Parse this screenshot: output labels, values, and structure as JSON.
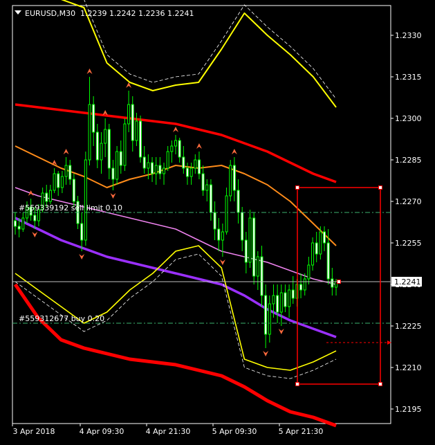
{
  "header": {
    "symbol": "EURUSD,M30",
    "ohlc": "1.2239 1.2242 1.2236 1.2241"
  },
  "chart_data": {
    "type": "line",
    "title": "EURUSD,M30  1.2239 1.2242 1.2236 1.2241",
    "xlabel": "",
    "ylabel": "",
    "ylim": [
      1.219,
      1.234
    ],
    "y_ticks": [
      1.233,
      1.2315,
      1.23,
      1.2285,
      1.227,
      1.2255,
      1.224,
      1.2225,
      1.221,
      1.2195
    ],
    "y_tick_labels": [
      "1.2330",
      "1.2315",
      "1.2300",
      "1.2285",
      "1.2270",
      "1.2255",
      "1.2240",
      "1.2225",
      "1.2210",
      "1.2195"
    ],
    "x_tick_labels": [
      "3 Apr 2018",
      "4 Apr 09:30",
      "4 Apr 21:30",
      "5 Apr 09:30",
      "5 Apr 21:30"
    ],
    "current_price": 1.2241,
    "current_price_label": "1.2241",
    "orders": [
      {
        "label": "#559339192 sell limit 0.10",
        "price": 1.2266
      },
      {
        "label": "#559312677 buy 0.20",
        "price": 1.2226
      }
    ],
    "candles": [
      [
        1.2263,
        1.2266,
        1.2258,
        1.2261
      ],
      [
        1.2261,
        1.2264,
        1.2257,
        1.226
      ],
      [
        1.226,
        1.2266,
        1.2259,
        1.2264
      ],
      [
        1.2264,
        1.227,
        1.2262,
        1.2268
      ],
      [
        1.2268,
        1.2271,
        1.2263,
        1.2265
      ],
      [
        1.2265,
        1.2268,
        1.226,
        1.2263
      ],
      [
        1.2263,
        1.2269,
        1.2261,
        1.2267
      ],
      [
        1.2267,
        1.2275,
        1.2266,
        1.2273
      ],
      [
        1.2273,
        1.2276,
        1.2268,
        1.227
      ],
      [
        1.227,
        1.2276,
        1.2269,
        1.2274
      ],
      [
        1.2274,
        1.2282,
        1.2273,
        1.228
      ],
      [
        1.228,
        1.2281,
        1.2272,
        1.2275
      ],
      [
        1.2275,
        1.2281,
        1.2273,
        1.2279
      ],
      [
        1.2279,
        1.2286,
        1.2276,
        1.2283
      ],
      [
        1.2283,
        1.2285,
        1.2276,
        1.2278
      ],
      [
        1.2278,
        1.228,
        1.2268,
        1.227
      ],
      [
        1.227,
        1.2272,
        1.226,
        1.2262
      ],
      [
        1.2262,
        1.2266,
        1.2252,
        1.2256
      ],
      [
        1.2256,
        1.2288,
        1.2254,
        1.2285
      ],
      [
        1.2285,
        1.2315,
        1.2283,
        1.2305
      ],
      [
        1.2305,
        1.2308,
        1.229,
        1.2295
      ],
      [
        1.2295,
        1.2298,
        1.2282,
        1.2285
      ],
      [
        1.2285,
        1.2295,
        1.228,
        1.2291
      ],
      [
        1.2291,
        1.23,
        1.2286,
        1.2296
      ],
      [
        1.2296,
        1.2298,
        1.2278,
        1.2282
      ],
      [
        1.2282,
        1.2285,
        1.2274,
        1.2278
      ],
      [
        1.2278,
        1.229,
        1.2276,
        1.2288
      ],
      [
        1.2288,
        1.2292,
        1.228,
        1.2283
      ],
      [
        1.2283,
        1.23,
        1.2281,
        1.2298
      ],
      [
        1.2298,
        1.231,
        1.2295,
        1.2305
      ],
      [
        1.2305,
        1.2308,
        1.2288,
        1.2292
      ],
      [
        1.2292,
        1.2302,
        1.229,
        1.2299
      ],
      [
        1.2299,
        1.2301,
        1.2284,
        1.2286
      ],
      [
        1.2286,
        1.229,
        1.228,
        1.2282
      ],
      [
        1.2282,
        1.2287,
        1.2278,
        1.2284
      ],
      [
        1.2284,
        1.2286,
        1.2277,
        1.228
      ],
      [
        1.228,
        1.2286,
        1.2276,
        1.2283
      ],
      [
        1.2283,
        1.2286,
        1.2278,
        1.228
      ],
      [
        1.228,
        1.2284,
        1.2276,
        1.2282
      ],
      [
        1.2282,
        1.229,
        1.2281,
        1.2288
      ],
      [
        1.2288,
        1.2292,
        1.2284,
        1.229
      ],
      [
        1.229,
        1.2294,
        1.2287,
        1.2292
      ],
      [
        1.2292,
        1.2293,
        1.2284,
        1.2286
      ],
      [
        1.2286,
        1.229,
        1.228,
        1.2282
      ],
      [
        1.2282,
        1.2284,
        1.2276,
        1.2279
      ],
      [
        1.2279,
        1.2284,
        1.2276,
        1.2282
      ],
      [
        1.2282,
        1.2287,
        1.228,
        1.2285
      ],
      [
        1.2285,
        1.2288,
        1.2278,
        1.228
      ],
      [
        1.228,
        1.2283,
        1.2272,
        1.2274
      ],
      [
        1.2274,
        1.2278,
        1.227,
        1.2276
      ],
      [
        1.2276,
        1.2278,
        1.2263,
        1.2266
      ],
      [
        1.2266,
        1.227,
        1.2256,
        1.226
      ],
      [
        1.226,
        1.2264,
        1.2252,
        1.2256
      ],
      [
        1.2256,
        1.2262,
        1.225,
        1.2259
      ],
      [
        1.2259,
        1.2275,
        1.2258,
        1.2272
      ],
      [
        1.2272,
        1.2285,
        1.227,
        1.2283
      ],
      [
        1.2283,
        1.2286,
        1.227,
        1.2274
      ],
      [
        1.2274,
        1.2278,
        1.2262,
        1.2266
      ],
      [
        1.2266,
        1.2268,
        1.2252,
        1.2256
      ],
      [
        1.2256,
        1.2259,
        1.2244,
        1.2248
      ],
      [
        1.2248,
        1.2267,
        1.2246,
        1.2264
      ],
      [
        1.2264,
        1.2266,
        1.224,
        1.2243
      ],
      [
        1.2243,
        1.2252,
        1.2238,
        1.225
      ],
      [
        1.225,
        1.2254,
        1.2232,
        1.2236
      ],
      [
        1.2236,
        1.224,
        1.2217,
        1.2222
      ],
      [
        1.2222,
        1.2236,
        1.2219,
        1.2233
      ],
      [
        1.2233,
        1.224,
        1.2228,
        1.2236
      ],
      [
        1.2236,
        1.224,
        1.2226,
        1.223
      ],
      [
        1.223,
        1.224,
        1.2225,
        1.2237
      ],
      [
        1.2237,
        1.224,
        1.223,
        1.2232
      ],
      [
        1.2232,
        1.224,
        1.2228,
        1.2238
      ],
      [
        1.2238,
        1.2243,
        1.2233,
        1.2235
      ],
      [
        1.2235,
        1.2242,
        1.2232,
        1.224
      ],
      [
        1.224,
        1.2244,
        1.2235,
        1.2238
      ],
      [
        1.2238,
        1.2244,
        1.2236,
        1.2242
      ],
      [
        1.2242,
        1.225,
        1.224,
        1.2247
      ],
      [
        1.2247,
        1.2257,
        1.2245,
        1.2255
      ],
      [
        1.2255,
        1.2259,
        1.2248,
        1.2251
      ],
      [
        1.2251,
        1.2261,
        1.2249,
        1.2259
      ],
      [
        1.2259,
        1.2261,
        1.2252,
        1.2255
      ],
      [
        1.2255,
        1.226,
        1.224,
        1.2242
      ],
      [
        1.2242,
        1.2246,
        1.2236,
        1.2239
      ],
      [
        1.2239,
        1.2242,
        1.2236,
        1.2241
      ]
    ],
    "series": [
      {
        "color": "#ff0000",
        "values": [
          1.2305,
          1.2304,
          1.2303,
          1.2302,
          1.2301,
          1.23,
          1.2299,
          1.2298,
          1.2296,
          1.2294,
          1.2291,
          1.2288,
          1.2284,
          1.228,
          1.2277
        ]
      },
      {
        "color": "#ff8c1a",
        "values": [
          1.229,
          1.2286,
          1.2282,
          1.2279,
          1.2275,
          1.2278,
          1.228,
          1.2283,
          1.2282,
          1.2283,
          1.228,
          1.2276,
          1.227,
          1.2262,
          1.2254
        ]
      },
      {
        "color": "#ee82ee",
        "values": [
          1.2275,
          1.2272,
          1.227,
          1.2268,
          1.2266,
          1.2264,
          1.2262,
          1.226,
          1.2256,
          1.2252,
          1.225,
          1.2248,
          1.2245,
          1.2242,
          1.224
        ]
      },
      {
        "color": "#9b30ff",
        "values": [
          1.2264,
          1.226,
          1.2256,
          1.2253,
          1.225,
          1.2248,
          1.2246,
          1.2244,
          1.2242,
          1.224,
          1.2236,
          1.2231,
          1.2227,
          1.2224,
          1.2221
        ]
      },
      {
        "color": "#ff0000",
        "values": [
          1.224,
          1.2228,
          1.222,
          1.2217,
          1.2215,
          1.2213,
          1.2212,
          1.2211,
          1.2209,
          1.2207,
          1.2203,
          1.2198,
          1.2194,
          1.2192,
          1.2189
        ]
      },
      {
        "color": "#ffff00",
        "values": [
          1.2244,
          1.2238,
          1.2232,
          1.2226,
          1.223,
          1.2238,
          1.2244,
          1.2252,
          1.2254,
          1.2246,
          1.2213,
          1.221,
          1.2209,
          1.2212,
          1.2216
        ]
      },
      {
        "color": "#ffff00",
        "values": [
          1.2353,
          1.2348,
          1.2343,
          1.234,
          1.232,
          1.2313,
          1.231,
          1.2312,
          1.2313,
          1.2325,
          1.2338,
          1.233,
          1.2323,
          1.2315,
          1.2304
        ]
      }
    ],
    "rectangle": {
      "y_top": 1.2275,
      "y_bottom": 1.2204,
      "color": "#ff0000"
    }
  }
}
